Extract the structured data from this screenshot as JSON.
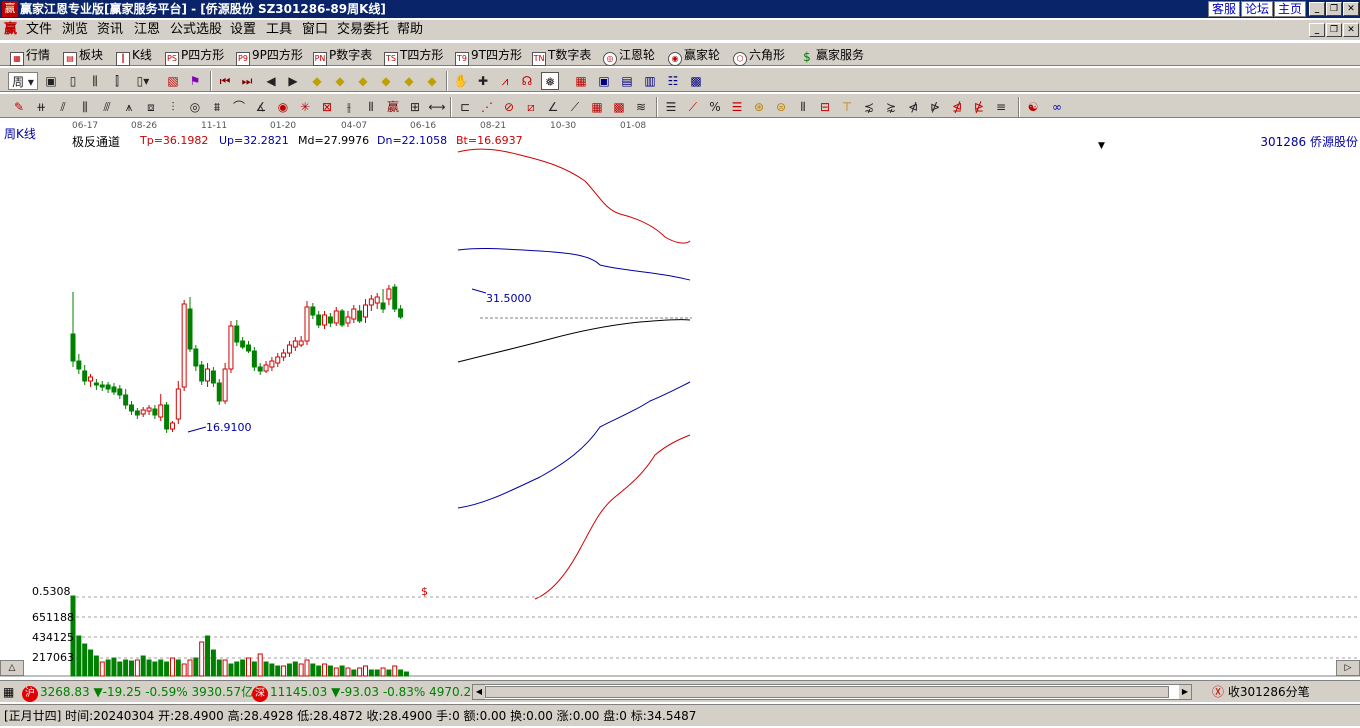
{
  "window": {
    "title": "赢家江恩专业版[赢家服务平台] - [侨源股份   SZ301286-89周K线]",
    "links": [
      "客服",
      "论坛",
      "主页"
    ]
  },
  "menu": [
    "文件",
    "浏览",
    "资讯",
    "江恩",
    "公式选股",
    "设置",
    "工具",
    "窗口",
    "交易委托",
    "帮助"
  ],
  "toolbar1": [
    {
      "label": "行情",
      "icon": "grid-icon"
    },
    {
      "label": "板块",
      "icon": "blocks-icon"
    },
    {
      "label": "K线",
      "icon": "candles-icon"
    },
    {
      "label": "P四方形",
      "icon": "PS"
    },
    {
      "label": "9P四方形",
      "icon": "P9"
    },
    {
      "label": "P数字表",
      "icon": "PN"
    },
    {
      "label": "T四方形",
      "icon": "TS"
    },
    {
      "label": "9T四方形",
      "icon": "T9"
    },
    {
      "label": "T数字表",
      "icon": "TN"
    },
    {
      "label": "江恩轮",
      "icon": "wheel-icon"
    },
    {
      "label": "赢家轮",
      "icon": "wheel2-icon"
    },
    {
      "label": "六角形",
      "icon": "hexagon-icon"
    },
    {
      "label": "赢家服务",
      "icon": "dollar-icon"
    }
  ],
  "period_selector": "周",
  "chart": {
    "period_label": "周K线",
    "date_ticks": [
      "06-17",
      "08-26",
      "11-11",
      "01-20",
      "04-07",
      "06-16",
      "08-21",
      "10-30",
      "01-08"
    ],
    "indicator_name": "极反通道",
    "indicator_values": [
      {
        "text": "Tp=36.1982",
        "color": "#d00000"
      },
      {
        "text": "Up=32.2821",
        "color": "#0000a0"
      },
      {
        "text": "Md=27.9976",
        "color": "#000000"
      },
      {
        "text": "Dn=22.1058",
        "color": "#0000a0"
      },
      {
        "text": "Bt=16.6937",
        "color": "#d00000"
      }
    ],
    "stock": "301286  侨源股份",
    "high_label": "31.5000",
    "low_label": "16.9100",
    "volume_axis": [
      "0.5308",
      "651188",
      "434125",
      "217063"
    ],
    "marker": "$"
  },
  "indices": [
    {
      "badge": "沪",
      "value": "3268.83",
      "change": "▼-19.25",
      "pct": "-0.59%",
      "amount": "3930.57亿"
    },
    {
      "badge": "深",
      "value": "11145.03",
      "change": "▼-93.03",
      "pct": "-0.83%",
      "amount": "4970.2"
    }
  ],
  "receive_text": "收301286分笔",
  "status_text": "[正月廿四] 时间:20240304 开:28.4900 高:28.4928 低:28.4872 收:28.4900 手:0 额:0.00 换:0.00 涨:0.00 盘:0 标:34.5487",
  "colors": {
    "up": "#d00000",
    "down": "#008000",
    "titlebar": "#0a246a",
    "panel": "#d4d0c8"
  }
}
